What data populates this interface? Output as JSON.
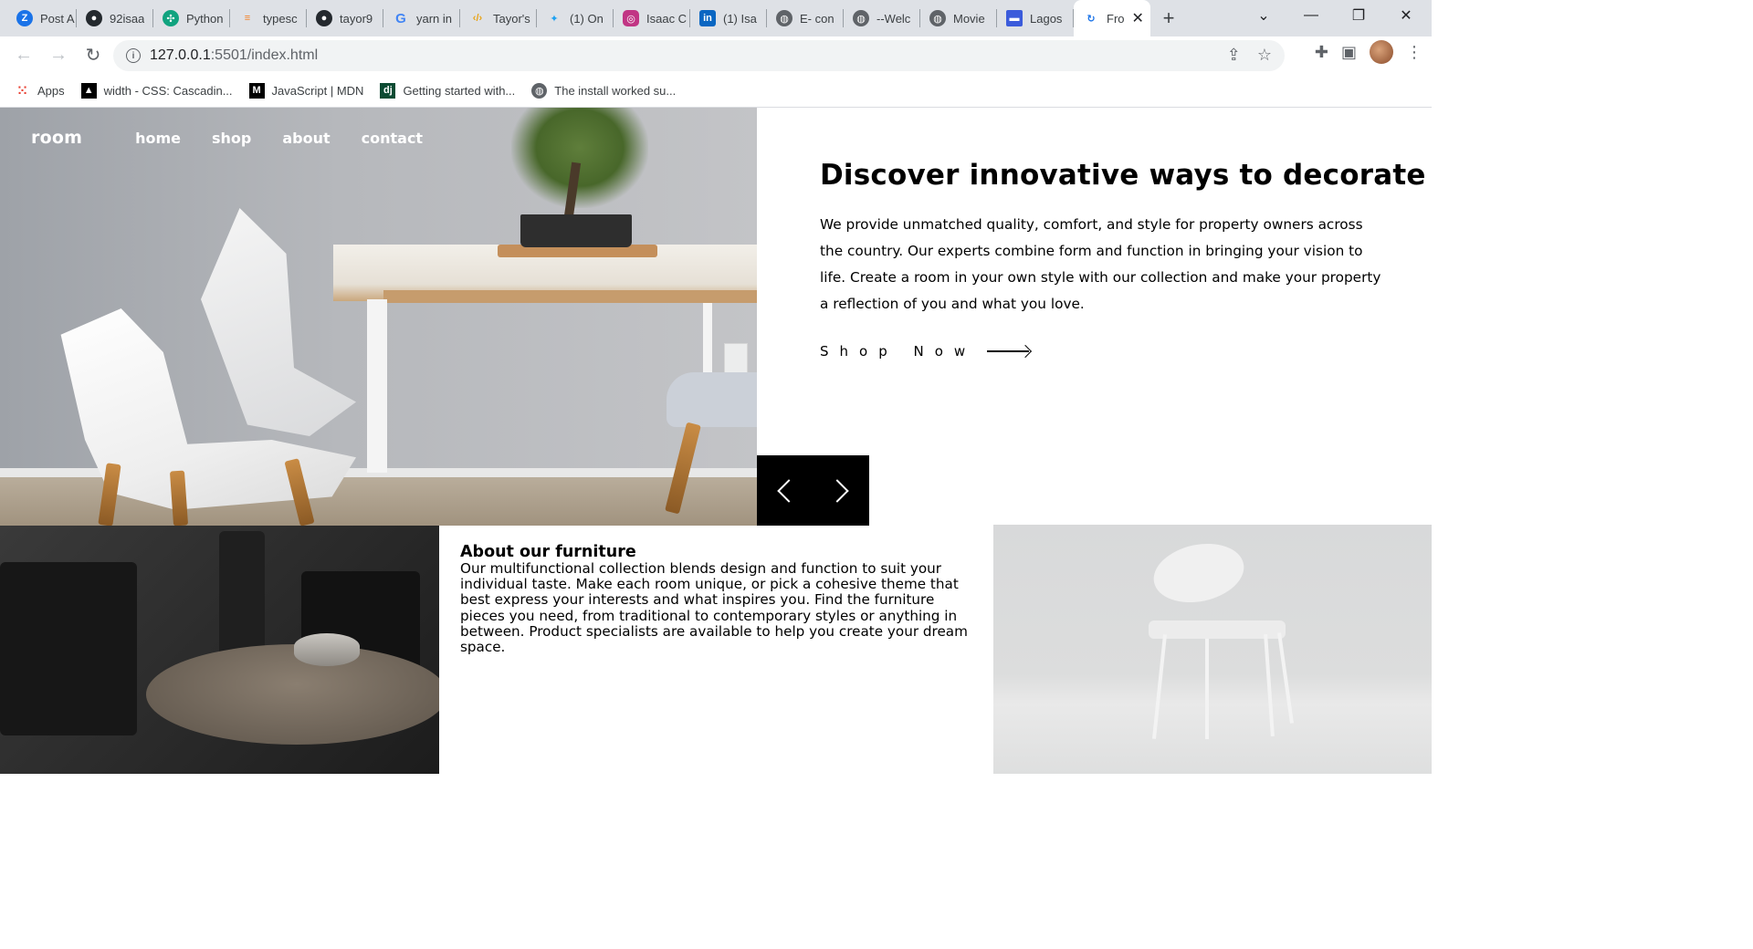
{
  "browser": {
    "tabs": [
      {
        "title": "Post A",
        "icon": "zoho-icon",
        "color": "#1a73e8"
      },
      {
        "title": "92isaa",
        "icon": "github-icon",
        "color": "#24292e"
      },
      {
        "title": "Python",
        "icon": "openai-icon",
        "color": "#10a37f"
      },
      {
        "title": "typesc",
        "icon": "stackoverflow-icon",
        "color": "#f48024"
      },
      {
        "title": "tayor9",
        "icon": "github-icon",
        "color": "#24292e"
      },
      {
        "title": "yarn in",
        "icon": "google-icon",
        "color": "#4285f4"
      },
      {
        "title": "Tayor's",
        "icon": "code-icon",
        "color": "#e8a317"
      },
      {
        "title": "(1) On",
        "icon": "twitter-icon",
        "color": "#1da1f2"
      },
      {
        "title": "Isaac C",
        "icon": "instagram-icon",
        "color": "#c13584"
      },
      {
        "title": "(1) Isa",
        "icon": "linkedin-icon",
        "color": "#0a66c2"
      },
      {
        "title": "E- con",
        "icon": "globe-icon",
        "color": "#5f6368"
      },
      {
        "title": "--Welc",
        "icon": "globe-icon",
        "color": "#5f6368"
      },
      {
        "title": "Movie",
        "icon": "globe-icon",
        "color": "#5f6368"
      },
      {
        "title": "Lagos",
        "icon": "flag-icon",
        "color": "#3b5bdb"
      }
    ],
    "active_tab": {
      "title": "Fro",
      "close": "✕"
    },
    "new_tab": "+",
    "url_host": "127.0.0.1",
    "url_rest": ":5501/index.html",
    "bookmarks": [
      {
        "label": "Apps",
        "icon": "apps-grid-icon"
      },
      {
        "label": "width - CSS: Cascadin...",
        "icon": "mdn-icon"
      },
      {
        "label": "JavaScript | MDN",
        "icon": "mdn-m-icon"
      },
      {
        "label": "Getting started with...",
        "icon": "django-icon"
      },
      {
        "label": "The install worked su...",
        "icon": "globe-icon"
      }
    ]
  },
  "site": {
    "logo": "room",
    "nav": [
      "home",
      "shop",
      "about",
      "contact"
    ],
    "hero": {
      "title": "Discover innovative ways to decorate",
      "description": "We provide unmatched quality, comfort, and style for property owners across the country. Our experts combine form and function in bringing your vision to life. Create a room in your own style with our collection and make your property a reflection of you and what you love.",
      "cta": "Shop Now"
    },
    "about": {
      "title": "About our furniture",
      "description": "Our multifunctional collection blends design and function to suit your individual taste. Make each room unique, or pick a cohesive theme that best express your interests and what inspires you. Find the furniture pieces you need, from traditional to contemporary styles or anything in between. Product specialists are available to help you create your dream space."
    }
  }
}
